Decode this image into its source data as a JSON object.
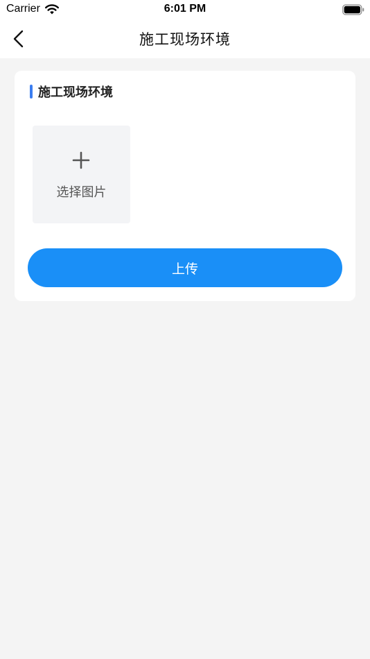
{
  "status_bar": {
    "carrier": "Carrier",
    "time": "6:01 PM",
    "icons": [
      "wifi-icon",
      "battery-icon"
    ]
  },
  "nav": {
    "title": "施工现场环境",
    "back_icon": "chevron-left-icon"
  },
  "section": {
    "title": "施工现场环境",
    "accent_color": "#3b7df0"
  },
  "picker": {
    "icon": "plus-icon",
    "label": "选择图片"
  },
  "upload": {
    "label": "上传",
    "color": "#1a8ff7"
  }
}
